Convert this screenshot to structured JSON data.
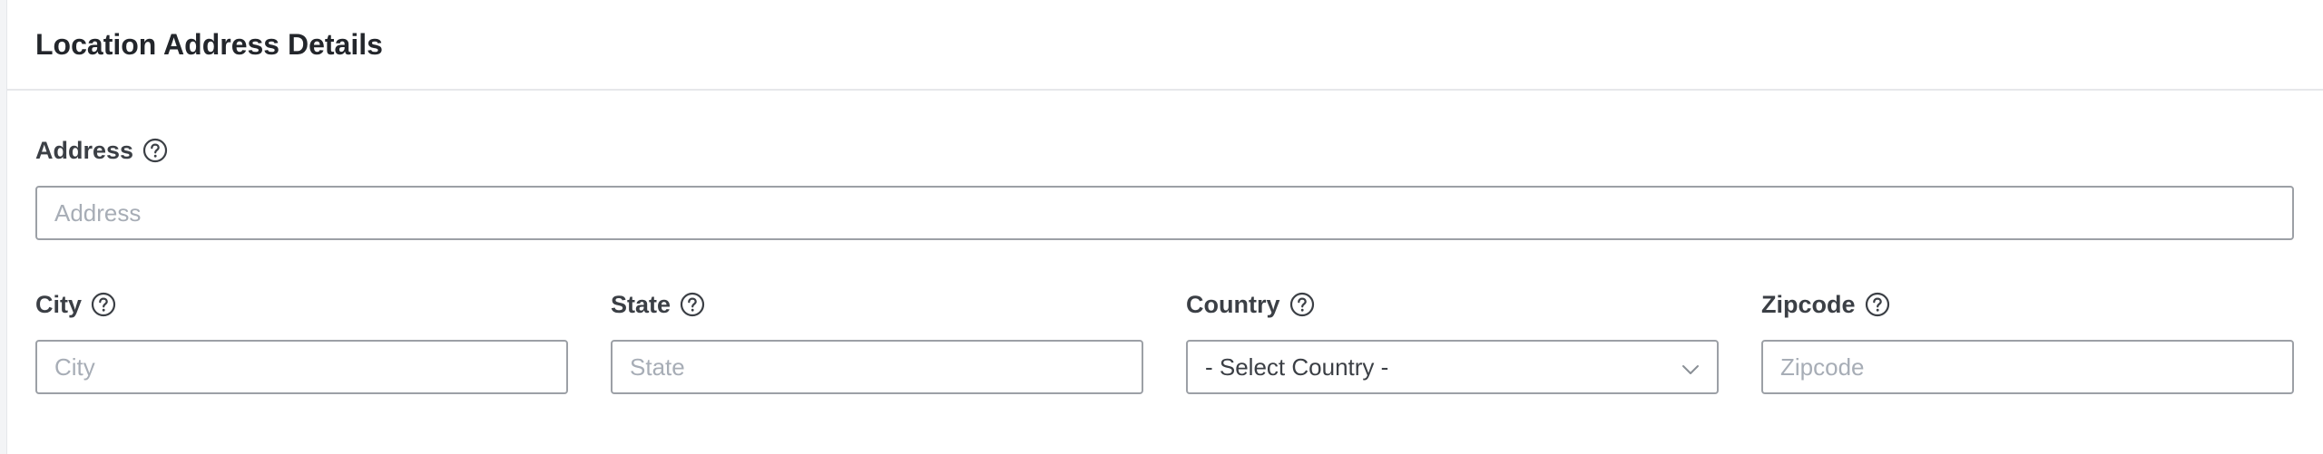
{
  "card": {
    "title": "Location Address Details"
  },
  "fields": {
    "address": {
      "label": "Address",
      "placeholder": "Address",
      "value": ""
    },
    "city": {
      "label": "City",
      "placeholder": "City",
      "value": ""
    },
    "state": {
      "label": "State",
      "placeholder": "State",
      "value": ""
    },
    "country": {
      "label": "Country",
      "selected": "- Select Country -"
    },
    "zipcode": {
      "label": "Zipcode",
      "placeholder": "Zipcode",
      "value": ""
    }
  },
  "icons": {
    "help": "help-circle-icon",
    "dropdown": "chevron-down-icon"
  },
  "colors": {
    "label": "#3b3f45",
    "title": "#23262b",
    "border": "#9ca0a6",
    "placeholder": "#a7adb6"
  }
}
